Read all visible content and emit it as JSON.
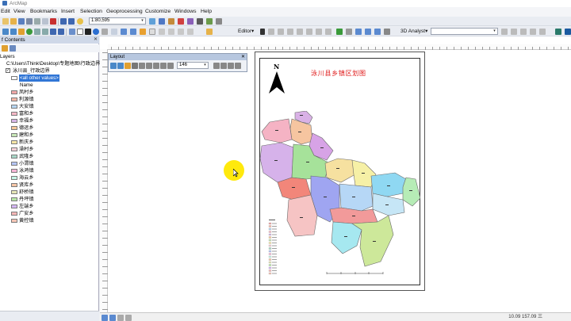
{
  "window": {
    "title": "ArcMap"
  },
  "menu": [
    "Edit",
    "View",
    "Bookmarks",
    "Insert",
    "Selection",
    "Geoprocessing",
    "Customize",
    "Windows",
    "Help"
  ],
  "toolbar": {
    "scale_value": "1:80,595",
    "editor_label": "Editor▾",
    "analyst_label": "3D Analyst▾"
  },
  "toc": {
    "header": "f Contents",
    "layers_label": "Layers",
    "path": "C:\\Users\\Think\\Desktop\\专题地图\\行政边界",
    "layer_name": "泳川县_行政边界",
    "all_other": "<all other values>",
    "field": "Name",
    "items": [
      {
        "label": "凤村乡",
        "color": "#f0a8a8"
      },
      {
        "label": "利源镇",
        "color": "#f4b6a6"
      },
      {
        "label": "大安镇",
        "color": "#b6d6f2"
      },
      {
        "label": "富和乡",
        "color": "#f6b8c6"
      },
      {
        "label": "幸福乡",
        "color": "#d6b6e6"
      },
      {
        "label": "德运乡",
        "color": "#f6c89a"
      },
      {
        "label": "建和乡",
        "color": "#c6e6b6"
      },
      {
        "label": "新庆乡",
        "color": "#f6e6a6"
      },
      {
        "label": "澡村乡",
        "color": "#f6d0d8"
      },
      {
        "label": "武隆乡",
        "color": "#a6d6c6"
      },
      {
        "label": "小渭镇",
        "color": "#b6c6f6"
      },
      {
        "label": "泳溡镇",
        "color": "#f6b6d6"
      },
      {
        "label": "海云乡",
        "color": "#c6f6e6"
      },
      {
        "label": "贤库乡",
        "color": "#f6c6a6"
      },
      {
        "label": "舒桥镇",
        "color": "#e6e6b6"
      },
      {
        "label": "丹坪镇",
        "color": "#b6e6a6"
      },
      {
        "label": "左端乡",
        "color": "#d6b6f6"
      },
      {
        "label": "广安乡",
        "color": "#f6b6b6"
      },
      {
        "label": "黄控镇",
        "color": "#f6c6b6"
      }
    ]
  },
  "layout_toolbar": {
    "title": "Layout",
    "zoom": "146"
  },
  "map": {
    "title": "泳川县乡镇区划图",
    "north": "N"
  },
  "status": {
    "coords": "10.09  157.09 三"
  }
}
